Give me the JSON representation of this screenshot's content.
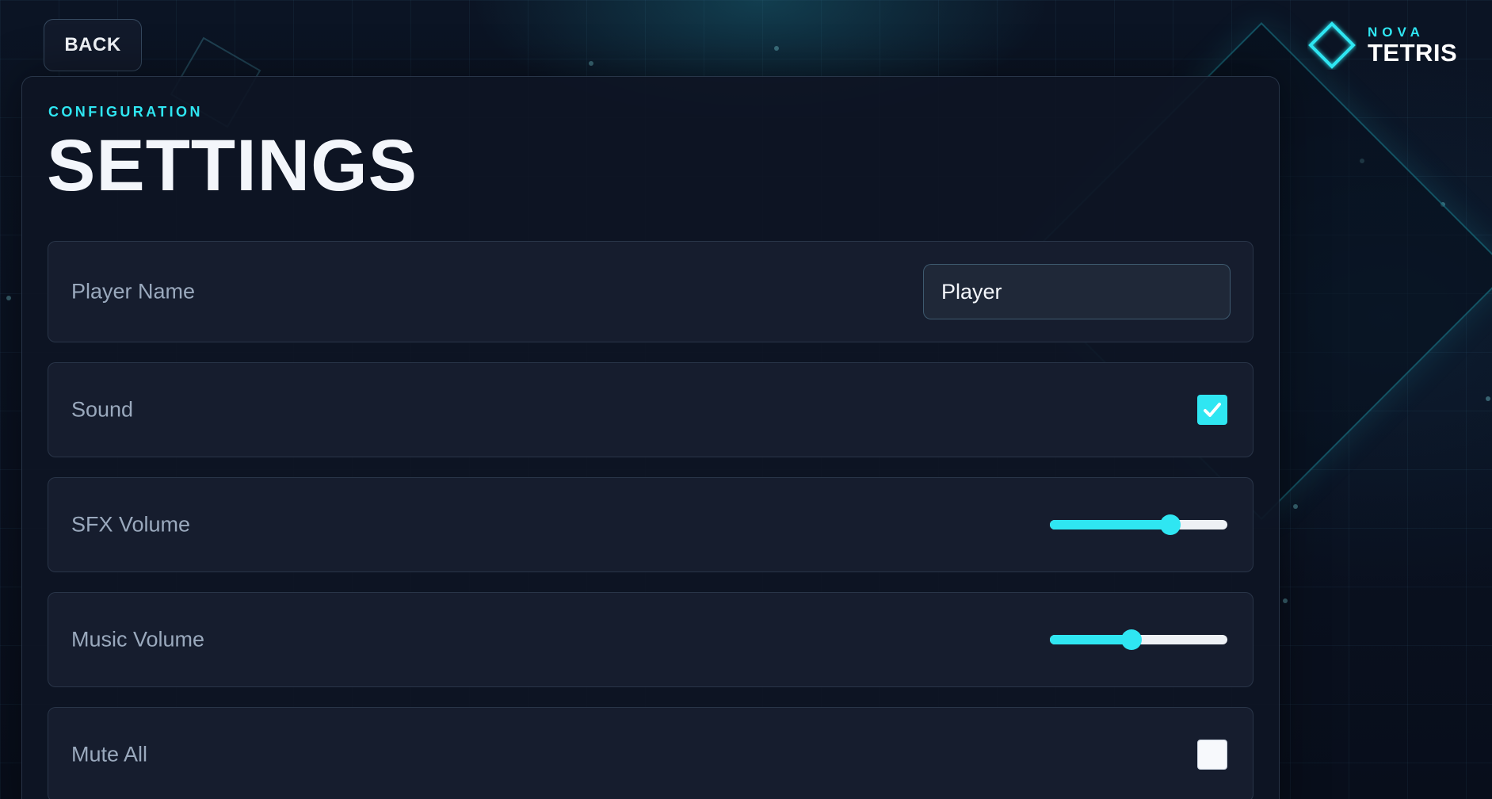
{
  "header": {
    "back_label": "BACK",
    "logo_small": "NOVA",
    "logo_big": "TETRIS"
  },
  "panel": {
    "eyebrow": "CONFIGURATION",
    "title": "SETTINGS"
  },
  "settings": {
    "player_name": {
      "label": "Player Name",
      "value": "Player"
    },
    "sound": {
      "label": "Sound",
      "checked": true
    },
    "sfx_volume": {
      "label": "SFX Volume",
      "level": 0.68
    },
    "music_volume": {
      "label": "Music Volume",
      "level": 0.46
    },
    "mute_all": {
      "label": "Mute All",
      "checked": false
    }
  },
  "colors": {
    "accent": "#2fe6f2",
    "background": "#0a1120",
    "panel": "#0e1524",
    "row": "#161d2e",
    "label": "#9aa9bd",
    "text": "#f3f6fb"
  },
  "icons": {
    "logo": "diamond-outline-icon",
    "check": "checkmark-icon"
  }
}
